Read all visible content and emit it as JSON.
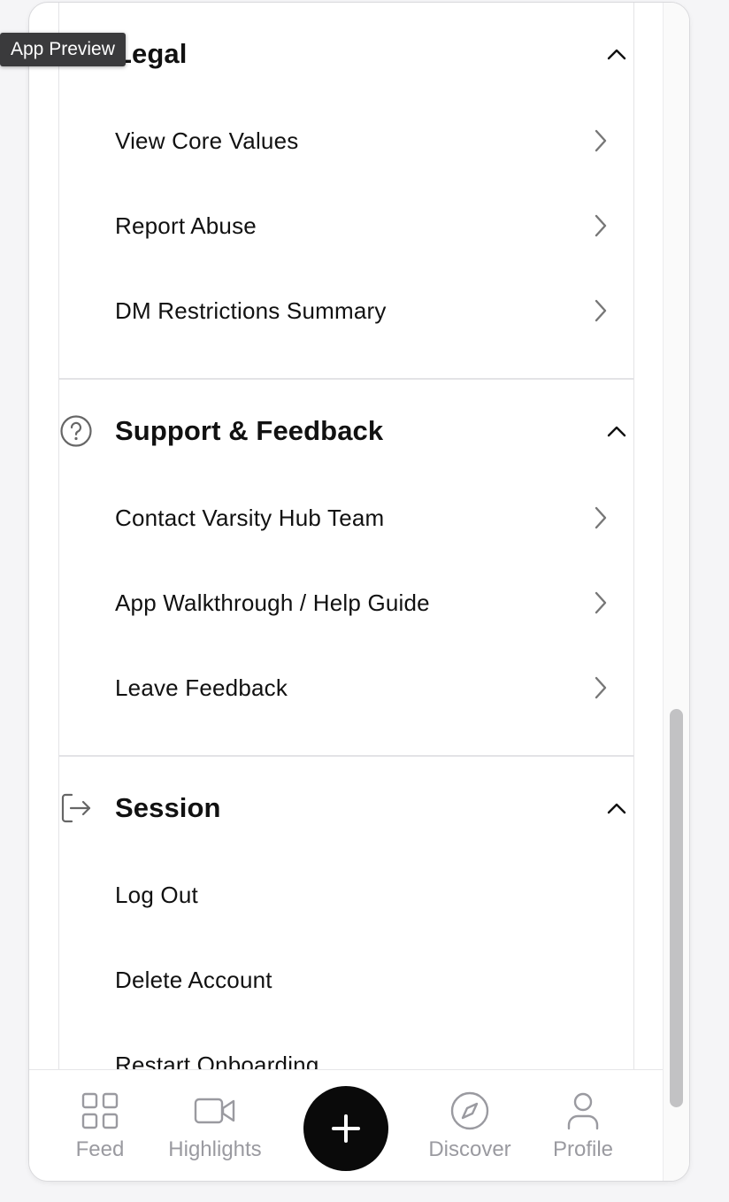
{
  "tooltip": {
    "label": "App Preview"
  },
  "sections": {
    "legal": {
      "title": "Legal",
      "items": [
        "View Core Values",
        "Report Abuse",
        "DM Restrictions Summary"
      ]
    },
    "support": {
      "title": "Support & Feedback",
      "icon": "help-circle-icon",
      "items": [
        "Contact Varsity Hub Team",
        "App Walkthrough / Help Guide",
        "Leave Feedback"
      ]
    },
    "session": {
      "title": "Session",
      "icon": "logout-icon",
      "items": [
        "Log Out",
        "Delete Account",
        "Restart Onboarding"
      ]
    }
  },
  "bottom_nav": {
    "feed": "Feed",
    "highlights": "Highlights",
    "discover": "Discover",
    "profile": "Profile"
  },
  "colors": {
    "text": "#111111",
    "muted": "#9a9aa0",
    "fab": "#0a0a0a",
    "divider": "#e3e3e6"
  }
}
